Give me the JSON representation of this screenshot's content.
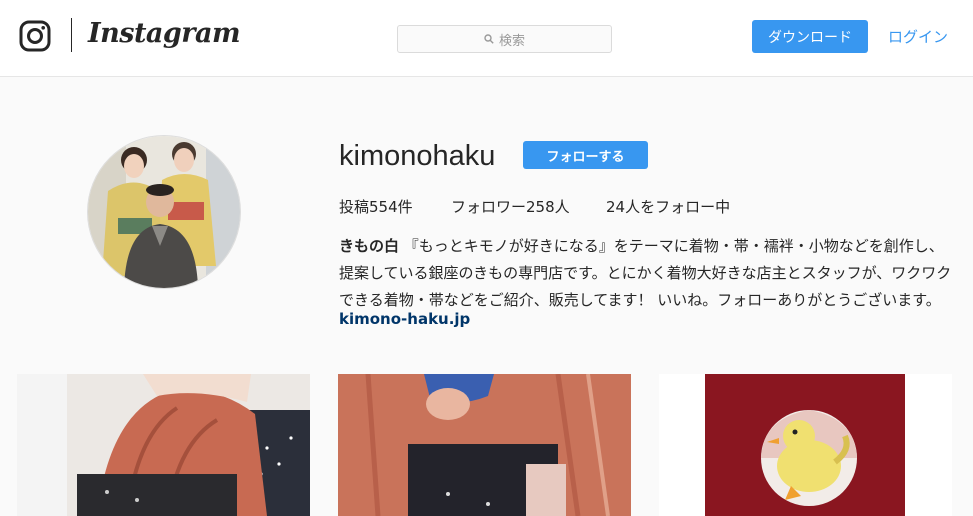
{
  "header": {
    "brand": "Instagram",
    "search_placeholder": "検索",
    "download_label": "ダウンロード",
    "login_label": "ログイン"
  },
  "profile": {
    "username": "kimonohaku",
    "follow_label": "フォローする",
    "stats": {
      "posts": "投稿554件",
      "followers": "フォロワー258人",
      "following": "24人をフォロー中"
    },
    "bio_name": "きもの白",
    "bio_text": "『もっとキモノが好きになる』をテーマに着物・帯・襦袢・小物などを創作し、提案している銀座のきもの専門店です。とにかく着物大好きな店主とスタッフが、ワクワクできる着物・帯などをご紹介、販売してます！ いいね。フォローありがとうございます。",
    "website": "kimono-haku.jp"
  },
  "colors": {
    "accent": "#3897f0",
    "link_dark": "#003569",
    "background": "#fafafa"
  }
}
